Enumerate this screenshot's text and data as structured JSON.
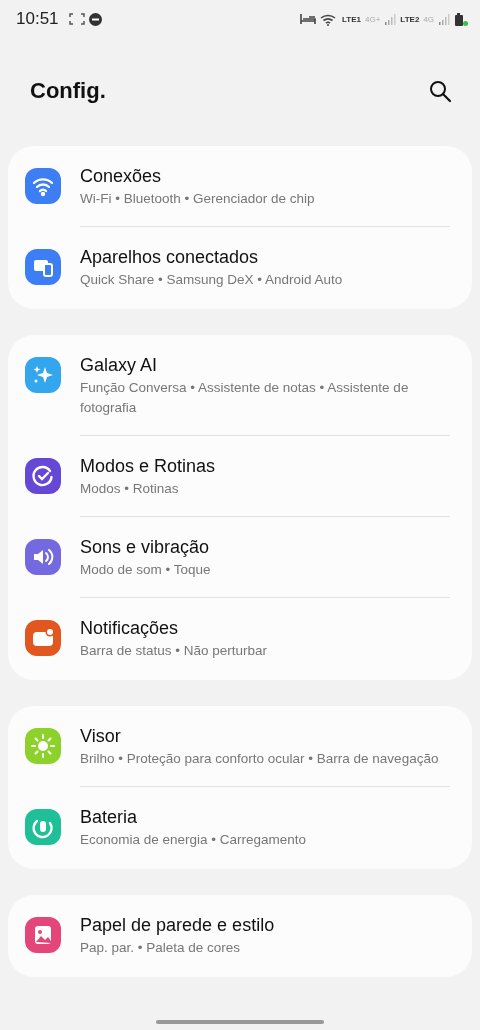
{
  "status_bar": {
    "time": "10:51",
    "sim1": "LTE1",
    "sim1_net": "4G+",
    "sim2": "LTE2",
    "sim2_net": "4G"
  },
  "header": {
    "title": "Config."
  },
  "groups": [
    {
      "items": [
        {
          "title": "Conexões",
          "subtitle": "Wi-Fi • Bluetooth • Gerenciador de chip",
          "kind": "wifi",
          "color": "#3d7ef5"
        },
        {
          "title": "Aparelhos conectados",
          "subtitle": "Quick Share • Samsung DeX • Android Auto",
          "kind": "devices",
          "color": "#3d7ef5"
        }
      ]
    },
    {
      "items": [
        {
          "title": "Galaxy AI",
          "subtitle": "Função Conversa • Assistente de notas • Assistente de fotografia",
          "kind": "sparkle",
          "color": "#34a6ee"
        },
        {
          "title": "Modos e Rotinas",
          "subtitle": "Modos • Rotinas",
          "kind": "check",
          "color": "#6548d6"
        },
        {
          "title": "Sons e vibração",
          "subtitle": "Modo de som • Toque",
          "kind": "sound",
          "color": "#7469df"
        },
        {
          "title": "Notificações",
          "subtitle": "Barra de status • Não perturbar",
          "kind": "notify",
          "color": "#e2571f"
        }
      ]
    },
    {
      "items": [
        {
          "title": "Visor",
          "subtitle": "Brilho • Proteção para conforto ocular • Barra de navegação",
          "kind": "sun",
          "color": "#8dd22a"
        },
        {
          "title": "Bateria",
          "subtitle": "Economia de energia • Carregamento",
          "kind": "battery",
          "color": "#1fbf98"
        }
      ]
    },
    {
      "items": [
        {
          "title": "Papel de parede e estilo",
          "subtitle": "Pap. par. • Paleta de cores",
          "kind": "image",
          "color": "#e4467a"
        }
      ]
    }
  ]
}
